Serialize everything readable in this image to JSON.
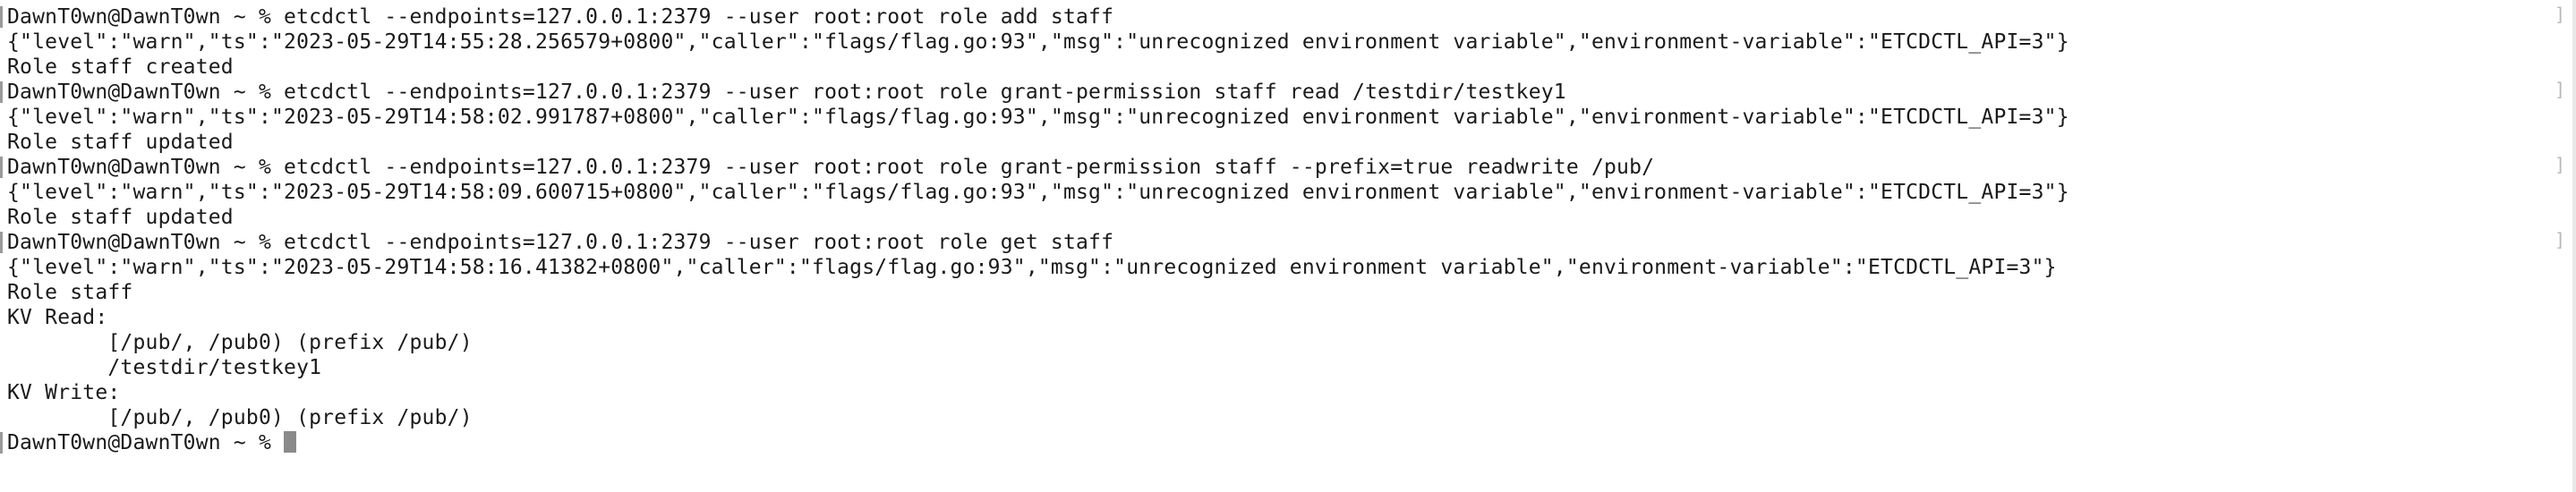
{
  "terminal": {
    "lines": [
      "DawnT0wn@DawnT0wn ~ % etcdctl --endpoints=127.0.0.1:2379 --user root:root role add staff",
      "{\"level\":\"warn\",\"ts\":\"2023-05-29T14:55:28.256579+0800\",\"caller\":\"flags/flag.go:93\",\"msg\":\"unrecognized environment variable\",\"environment-variable\":\"ETCDCTL_API=3\"}",
      "Role staff created",
      "DawnT0wn@DawnT0wn ~ % etcdctl --endpoints=127.0.0.1:2379 --user root:root role grant-permission staff read /testdir/testkey1",
      "{\"level\":\"warn\",\"ts\":\"2023-05-29T14:58:02.991787+0800\",\"caller\":\"flags/flag.go:93\",\"msg\":\"unrecognized environment variable\",\"environment-variable\":\"ETCDCTL_API=3\"}",
      "Role staff updated",
      "DawnT0wn@DawnT0wn ~ % etcdctl --endpoints=127.0.0.1:2379 --user root:root role grant-permission staff --prefix=true readwrite /pub/",
      "{\"level\":\"warn\",\"ts\":\"2023-05-29T14:58:09.600715+0800\",\"caller\":\"flags/flag.go:93\",\"msg\":\"unrecognized environment variable\",\"environment-variable\":\"ETCDCTL_API=3\"}",
      "Role staff updated",
      "DawnT0wn@DawnT0wn ~ % etcdctl --endpoints=127.0.0.1:2379 --user root:root role get staff",
      "{\"level\":\"warn\",\"ts\":\"2023-05-29T14:58:16.41382+0800\",\"caller\":\"flags/flag.go:93\",\"msg\":\"unrecognized environment variable\",\"environment-variable\":\"ETCDCTL_API=3\"}",
      "Role staff",
      "KV Read:",
      "        [/pub/, /pub0) (prefix /pub/)",
      "        /testdir/testkey1",
      "KV Write:",
      "        [/pub/, /pub0) (prefix /pub/)"
    ],
    "prompt": "DawnT0wn@DawnT0wn ~ % "
  },
  "colors": {
    "background": "#ffffff",
    "text": "#1a1a1a",
    "cursor": "#8a8a8a"
  }
}
